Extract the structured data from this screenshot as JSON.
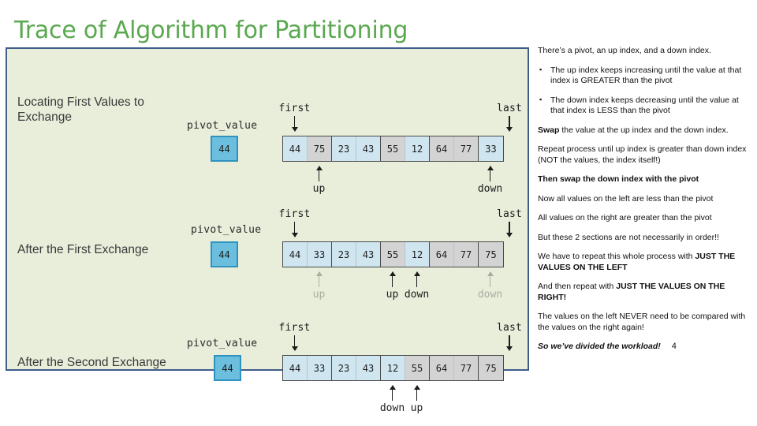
{
  "slide": {
    "title": "Trace of Algorithm for Partitioning",
    "page_number": "4",
    "title_color": "#5aa84f",
    "panel_bg": "#e8eeda",
    "panel_border": "#3f5d8a",
    "pivot_fill": "#6cbede",
    "cell_blue": "#cfe5ef",
    "cell_gray": "#d3d3d3"
  },
  "diagram": {
    "pivot_caption": "pivot_value",
    "first_label": "first",
    "last_label": "last",
    "up_label": "up",
    "down_label": "down",
    "rows": [
      {
        "label": "Locating First Values to Exchange",
        "pivot": "44",
        "cells": [
          {
            "value": "44",
            "shade": "blue"
          },
          {
            "value": "75",
            "shade": "gray"
          },
          {
            "value": "23",
            "shade": "blue"
          },
          {
            "value": "43",
            "shade": "blue"
          },
          {
            "value": "55",
            "shade": "gray"
          },
          {
            "value": "12",
            "shade": "blue"
          },
          {
            "value": "64",
            "shade": "gray"
          },
          {
            "value": "77",
            "shade": "gray"
          },
          {
            "value": "33",
            "shade": "blue"
          }
        ],
        "markers": [
          {
            "label": "up",
            "index": 1,
            "faded": false
          },
          {
            "label": "down",
            "index": 8,
            "faded": false
          }
        ]
      },
      {
        "label": "After the First Exchange",
        "pivot": "44",
        "cells": [
          {
            "value": "44",
            "shade": "blue"
          },
          {
            "value": "33",
            "shade": "blue"
          },
          {
            "value": "23",
            "shade": "blue"
          },
          {
            "value": "43",
            "shade": "blue"
          },
          {
            "value": "55",
            "shade": "gray"
          },
          {
            "value": "12",
            "shade": "blue"
          },
          {
            "value": "64",
            "shade": "gray"
          },
          {
            "value": "77",
            "shade": "gray"
          },
          {
            "value": "75",
            "shade": "gray"
          }
        ],
        "markers": [
          {
            "label": "up",
            "index": 1,
            "faded": true
          },
          {
            "label": "up",
            "index": 4,
            "faded": false
          },
          {
            "label": "down",
            "index": 5,
            "faded": false
          },
          {
            "label": "down",
            "index": 8,
            "faded": true
          }
        ]
      },
      {
        "label": "After the Second Exchange",
        "pivot": "44",
        "cells": [
          {
            "value": "44",
            "shade": "blue"
          },
          {
            "value": "33",
            "shade": "blue"
          },
          {
            "value": "23",
            "shade": "blue"
          },
          {
            "value": "43",
            "shade": "blue"
          },
          {
            "value": "12",
            "shade": "blue"
          },
          {
            "value": "55",
            "shade": "gray"
          },
          {
            "value": "64",
            "shade": "gray"
          },
          {
            "value": "77",
            "shade": "gray"
          },
          {
            "value": "75",
            "shade": "gray"
          }
        ],
        "markers": [
          {
            "label": "down",
            "index": 4,
            "faded": false
          },
          {
            "label": "up",
            "index": 5,
            "faded": false
          }
        ]
      }
    ]
  },
  "notes": {
    "intro": "There’s a pivot, an up index, and a down index.",
    "bullets": [
      "The up index keeps increasing until the value at that index is GREATER than the pivot",
      "The down index keeps decreasing until the value at that index is LESS than the pivot"
    ],
    "swap_bold": "Swap",
    "swap_rest": " the value at the up index and the down index.",
    "repeat": "Repeat process until up index is greater than down index (NOT the values, the index itself!)",
    "then_swap": "Then swap the down index with the pivot",
    "left_less": "Now all values on the left are less than the pivot",
    "right_greater": "All values on the right are greater than the pivot",
    "not_ordered": "But these 2 sections are not necessarily in order!!",
    "repeat_left_plain": "We have to repeat this whole process with ",
    "repeat_left_bold": "JUST THE VALUES ON THE LEFT",
    "repeat_right_plain": "And then repeat with ",
    "repeat_right_bold": "JUST THE VALUES ON THE RIGHT!",
    "never_compared": "The values on the left NEVER need to be compared with the values on the right again!",
    "conclusion": "So we’ve divided the workload!"
  }
}
